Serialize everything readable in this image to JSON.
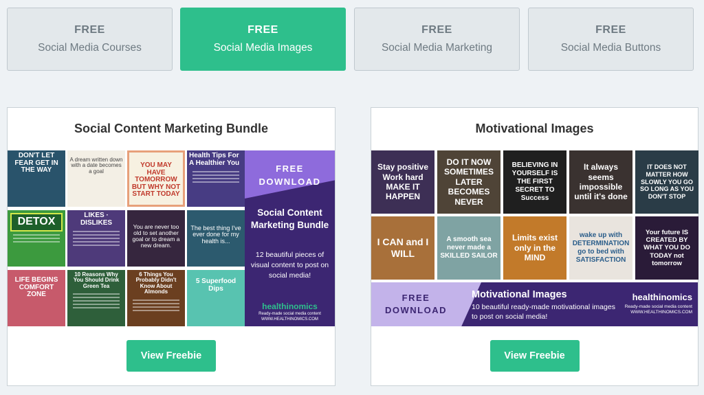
{
  "tabs": [
    {
      "label_top": "FREE",
      "label_bottom": "Social Media Courses",
      "active": false
    },
    {
      "label_top": "FREE",
      "label_bottom": "Social Media Images",
      "active": true
    },
    {
      "label_top": "FREE",
      "label_bottom": "Social Media Marketing",
      "active": false
    },
    {
      "label_top": "FREE",
      "label_bottom": "Social Media Buttons",
      "active": false
    }
  ],
  "bundle": {
    "title": "Social Content Marketing Bundle",
    "button_label": "View Freebie",
    "tiles": [
      {
        "text": "DON'T LET FEAR GET IN THE WAY",
        "bg": "#29536b"
      },
      {
        "text": "A dream written down with a date becomes a goal",
        "bg": "#f3efe5"
      },
      {
        "text": "YOU MAY HAVE TOMORROW BUT WHY NOT START TODAY",
        "bg": "#f7f1e1"
      },
      {
        "text": "Health Tips For A Healthier You",
        "bg": "#473c83"
      },
      {
        "text": "DETOX",
        "bg": "#3c9a3e"
      },
      {
        "text": "LIKES · DISLIKES",
        "bg": "#4e3a7a"
      },
      {
        "text": "You are never too old to set another goal or to dream a new dream.",
        "bg": "#36263e"
      },
      {
        "text": "The best thing I've ever done for my health is...",
        "bg": "#2c5a6e"
      },
      {
        "text": "LIFE BEGINS COMFORT ZONE",
        "bg": "#c75a6b"
      },
      {
        "text": "10 Reasons Why You Should Drink Green Tea",
        "bg": "#2e5f3a"
      },
      {
        "text": "6 Things You Probably Didn't Know About Almonds",
        "bg": "#6b3f20"
      },
      {
        "text": "5 Superfood Dips",
        "bg": "#58c3b0"
      }
    ],
    "promo": {
      "free_line1": "FREE",
      "free_line2": "DOWNLOAD",
      "title": "Social Content Marketing Bundle",
      "description": "12 beautiful pieces of visual content to post on social media!",
      "brand": "healthinomics",
      "tagline": "Ready-made social media content",
      "url": "WWW.HEALTHINOMICS.COM"
    }
  },
  "motivational": {
    "title": "Motivational Images",
    "button_label": "View Freebie",
    "tiles": [
      {
        "text": "Stay positive Work hard MAKE IT HAPPEN",
        "bg": "#3d2f55"
      },
      {
        "text": "DO IT NOW SOMETIMES LATER BECOMES NEVER",
        "bg": "#4f4437"
      },
      {
        "text": "BELIEVING IN YOURSELF IS THE FIRST SECRET TO Success",
        "bg": "#1f1f1f"
      },
      {
        "text": "It always seems impossible until it's done",
        "bg": "#3a3230"
      },
      {
        "text": "IT DOES NOT MATTER HOW SLOWLY YOU GO SO LONG AS YOU DON'T STOP",
        "bg": "#2a3c47"
      },
      {
        "text": "I CAN and I WILL",
        "bg": "#a8703a"
      },
      {
        "text": "A smooth sea never made a SKILLED SAILOR",
        "bg": "#7fa3a3"
      },
      {
        "text": "Limits exist only in the MIND",
        "bg": "#c27a2a"
      },
      {
        "text": "wake up with DETERMINATION go to bed with SATISFACTION",
        "bg": "#e9e4de"
      },
      {
        "text": "Your future IS CREATED BY WHAT YOU DO TODAY not tomorrow",
        "bg": "#2a1b38"
      }
    ],
    "banner": {
      "free_line1": "FREE",
      "free_line2": "DOWNLOAD",
      "title": "Motivational Images",
      "description": "10 beautiful ready-made motivational images to post on social media!",
      "brand": "healthinomics",
      "tagline": "Ready-made social media content",
      "url": "WWW.HEALTHINOMICS.COM"
    }
  },
  "colors": {
    "accent": "#2ebf8c",
    "purple": "#3c2672",
    "lavender": "#8e6bdc"
  }
}
